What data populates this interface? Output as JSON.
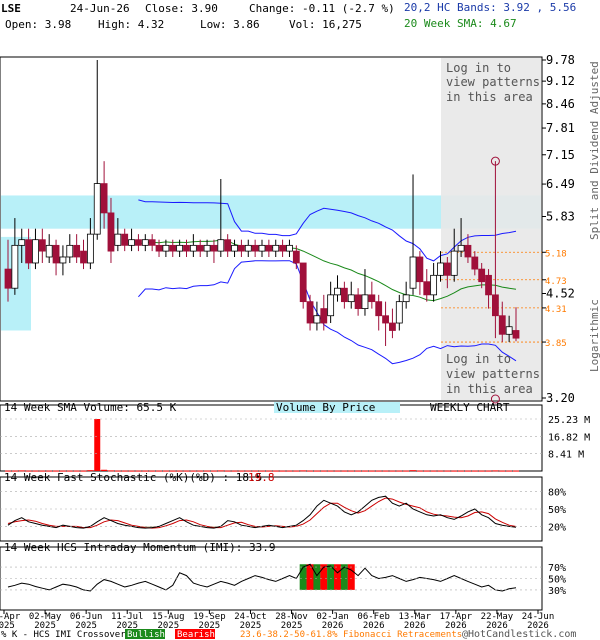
{
  "header": {
    "symbol": "LSE",
    "date": "24-Jun-26",
    "close": "Close: 3.90",
    "change": "Change: -0.11 (-2.7 %)",
    "open": "Open: 3.98",
    "high": "High: 4.32",
    "low": "Low: 3.86",
    "vol": "Vol: 16,275",
    "bands": "20,2 HC Bands: 3.92 , 5.56",
    "sma": "20 Week SMA: 4.67"
  },
  "price_panel": {
    "side_label_top": "Split and Dividend Adjusted",
    "side_label_bottom": "Logarithmic",
    "login_top": [
      "Log in to",
      "view patterns",
      "in this area"
    ],
    "login_bottom": [
      "Log in to",
      "view patterns",
      "in this area"
    ]
  },
  "volume_panel": {
    "title": "14 Week SMA Volume: 65.5 K",
    "center": "Volume By Price",
    "right": "WEEKLY CHART",
    "y_ticks": [
      "25.23 M",
      "16.82 M",
      "8.41 M"
    ]
  },
  "stoch_panel": {
    "title": "14 Week Fast Stochastic (%K)(%D) : 18.5",
    "d_value": "19.8",
    "y_ticks": [
      "80%",
      "50%",
      "20%"
    ]
  },
  "imi_panel": {
    "title": "14 Week HCS Intraday Momentum (IMI): 33.9",
    "y_ticks": [
      "70%",
      "50%",
      "30%"
    ]
  },
  "footer": {
    "legend_prefix": "% K - HCS IMI Crossover,",
    "bullish": "Bullish",
    "bearish": "Bearish",
    "fib": "23.6-38.2-50-61.8% Fibonacci Retracements",
    "credit": "@HotCandlestick.com"
  },
  "colors": {
    "up": "#ffffff",
    "down": "#a0103a",
    "band": "#1a1aff",
    "sma": "#1b8a1b",
    "cyan_zone": "#b8f0f8",
    "fib": "#ff7a00",
    "header_blue": "#1a3aa8",
    "header_green": "#1b8a1b",
    "volume_bar": "#ff0000"
  },
  "chart_data": {
    "type": "candlestick",
    "scale": "log",
    "y_ticks": [
      9.78,
      9.12,
      8.46,
      7.81,
      7.15,
      6.49,
      5.83,
      5.18,
      4.73,
      4.52,
      4.31,
      3.85,
      3.2
    ],
    "fib_levels": [
      5.18,
      4.73,
      4.31,
      3.85
    ],
    "x_labels": [
      [
        "04-Apr",
        "2025"
      ],
      [
        "02-May",
        "2025"
      ],
      [
        "06-Jun",
        "2025"
      ],
      [
        "11-Jul",
        "2025"
      ],
      [
        "15-Aug",
        "2025"
      ],
      [
        "19-Sep",
        "2025"
      ],
      [
        "24-Oct",
        "2025"
      ],
      [
        "28-Nov",
        "2025"
      ],
      [
        "02-Jan",
        "2026"
      ],
      [
        "06-Feb",
        "2026"
      ],
      [
        "13-Mar",
        "2026"
      ],
      [
        "17-Apr",
        "2026"
      ],
      [
        "22-May",
        "2026"
      ],
      [
        "24-Jun",
        "2026"
      ]
    ],
    "candles": [
      [
        4.9,
        4.6,
        5.4,
        4.4
      ],
      [
        4.6,
        5.3,
        5.8,
        4.5
      ],
      [
        5.3,
        5.4,
        5.6,
        5.0
      ],
      [
        5.4,
        5.0,
        5.6,
        4.9
      ],
      [
        5.0,
        5.4,
        5.6,
        4.9
      ],
      [
        5.4,
        5.2,
        5.6,
        5.0
      ],
      [
        5.1,
        5.3,
        5.5,
        5.0
      ],
      [
        5.3,
        5.0,
        5.4,
        4.8
      ],
      [
        5.0,
        5.1,
        5.3,
        4.8
      ],
      [
        5.1,
        5.3,
        5.5,
        5.0
      ],
      [
        5.3,
        5.1,
        5.5,
        5.0
      ],
      [
        5.2,
        5.0,
        5.4,
        4.9
      ],
      [
        5.0,
        5.5,
        5.8,
        4.9
      ],
      [
        5.5,
        6.5,
        9.78,
        5.4
      ],
      [
        6.5,
        5.9,
        7.0,
        5.6
      ],
      [
        5.9,
        5.2,
        6.2,
        5.0
      ],
      [
        5.3,
        5.5,
        5.8,
        5.2
      ],
      [
        5.5,
        5.3,
        5.6,
        5.2
      ],
      [
        5.3,
        5.4,
        5.6,
        5.2
      ],
      [
        5.4,
        5.3,
        5.5,
        5.2
      ],
      [
        5.3,
        5.4,
        5.5,
        5.2
      ],
      [
        5.4,
        5.3,
        5.5,
        5.2
      ],
      [
        5.3,
        5.2,
        5.4,
        5.1
      ],
      [
        5.2,
        5.3,
        5.4,
        5.1
      ],
      [
        5.3,
        5.2,
        5.4,
        5.1
      ],
      [
        5.2,
        5.3,
        5.4,
        5.1
      ],
      [
        5.3,
        5.2,
        5.4,
        5.1
      ],
      [
        5.2,
        5.3,
        5.5,
        5.1
      ],
      [
        5.3,
        5.2,
        5.4,
        5.1
      ],
      [
        5.2,
        5.3,
        5.4,
        5.1
      ],
      [
        5.3,
        5.2,
        5.4,
        5.0
      ],
      [
        5.2,
        5.4,
        6.6,
        5.1
      ],
      [
        5.4,
        5.2,
        5.5,
        5.1
      ],
      [
        5.2,
        5.3,
        5.4,
        5.1
      ],
      [
        5.3,
        5.2,
        5.4,
        5.1
      ],
      [
        5.2,
        5.3,
        5.4,
        5.1
      ],
      [
        5.3,
        5.2,
        5.4,
        5.1
      ],
      [
        5.2,
        5.3,
        5.4,
        5.1
      ],
      [
        5.3,
        5.2,
        5.4,
        5.1
      ],
      [
        5.2,
        5.3,
        5.4,
        5.1
      ],
      [
        5.3,
        5.2,
        5.4,
        5.1
      ],
      [
        5.2,
        5.3,
        5.4,
        5.1
      ],
      [
        5.2,
        5.0,
        5.3,
        4.9
      ],
      [
        5.0,
        4.4,
        5.0,
        4.3
      ],
      [
        4.4,
        4.1,
        4.5,
        4.0
      ],
      [
        4.1,
        4.2,
        4.4,
        4.0
      ],
      [
        4.3,
        4.1,
        4.5,
        4.0
      ],
      [
        4.2,
        4.5,
        4.7,
        4.1
      ],
      [
        4.5,
        4.6,
        4.8,
        4.4
      ],
      [
        4.6,
        4.4,
        4.7,
        4.3
      ],
      [
        4.4,
        4.5,
        4.7,
        4.3
      ],
      [
        4.5,
        4.3,
        4.6,
        4.2
      ],
      [
        4.3,
        4.5,
        4.9,
        4.2
      ],
      [
        4.5,
        4.4,
        4.7,
        4.3
      ],
      [
        4.4,
        4.2,
        4.5,
        4.0
      ],
      [
        4.2,
        4.1,
        4.4,
        3.8
      ],
      [
        4.1,
        4.0,
        4.3,
        3.9
      ],
      [
        4.1,
        4.4,
        4.5,
        4.0
      ],
      [
        4.4,
        4.5,
        4.7,
        4.3
      ],
      [
        4.6,
        5.1,
        6.7,
        4.5
      ],
      [
        5.1,
        4.7,
        5.2,
        4.5
      ],
      [
        4.7,
        4.5,
        4.9,
        4.4
      ],
      [
        4.5,
        4.8,
        5.0,
        4.4
      ],
      [
        4.8,
        5.0,
        5.2,
        4.7
      ],
      [
        5.0,
        4.8,
        5.1,
        4.6
      ],
      [
        4.8,
        5.2,
        5.6,
        4.7
      ],
      [
        5.2,
        5.3,
        5.8,
        5.1
      ],
      [
        5.3,
        5.1,
        5.5,
        5.0
      ],
      [
        5.1,
        4.9,
        5.2,
        4.8
      ],
      [
        4.9,
        4.7,
        5.0,
        4.6
      ],
      [
        4.8,
        4.5,
        4.9,
        4.3
      ],
      [
        4.5,
        4.2,
        7.0,
        3.9
      ],
      [
        4.2,
        3.95,
        4.4,
        3.85
      ],
      [
        3.95,
        4.05,
        4.2,
        3.85
      ],
      [
        4.0,
        3.9,
        4.32,
        3.86
      ]
    ],
    "volume": [
      0.2,
      0.2,
      0.3,
      0.2,
      0.2,
      0.2,
      0.2,
      0.2,
      0.2,
      0.2,
      0.2,
      0.2,
      0.4,
      25.23,
      0.6,
      0.3,
      0.2,
      0.2,
      0.2,
      0.2,
      0.2,
      0.2,
      0.2,
      0.2,
      0.2,
      0.2,
      0.2,
      0.2,
      0.2,
      0.2,
      0.2,
      0.3,
      0.2,
      0.2,
      0.2,
      0.2,
      0.2,
      0.2,
      0.2,
      0.2,
      0.2,
      0.2,
      0.2,
      0.3,
      0.2,
      0.2,
      0.2,
      0.2,
      0.2,
      0.2,
      0.2,
      0.2,
      0.2,
      0.2,
      0.2,
      0.2,
      0.2,
      0.2,
      0.2,
      0.4,
      0.2,
      0.2,
      0.2,
      0.2,
      0.2,
      0.2,
      0.2,
      0.2,
      0.2,
      0.2,
      0.2,
      0.3,
      0.2,
      0.2,
      0.2
    ],
    "stoch_k": [
      22,
      30,
      35,
      28,
      25,
      22,
      20,
      18,
      22,
      20,
      18,
      17,
      20,
      28,
      35,
      30,
      25,
      22,
      20,
      18,
      17,
      18,
      20,
      25,
      30,
      35,
      28,
      22,
      20,
      18,
      17,
      20,
      30,
      28,
      22,
      20,
      18,
      20,
      22,
      20,
      18,
      20,
      22,
      30,
      40,
      55,
      65,
      60,
      55,
      45,
      40,
      45,
      55,
      65,
      70,
      72,
      60,
      55,
      60,
      50,
      45,
      40,
      38,
      40,
      35,
      32,
      38,
      45,
      50,
      40,
      35,
      25,
      22,
      20,
      18.5
    ],
    "stoch_d": [
      25,
      28,
      30,
      31,
      29,
      25,
      22,
      20,
      20,
      20,
      20,
      18,
      18,
      22,
      28,
      31,
      30,
      26,
      22,
      20,
      18,
      17,
      18,
      21,
      25,
      30,
      31,
      28,
      23,
      20,
      18,
      18,
      22,
      26,
      27,
      23,
      20,
      19,
      20,
      21,
      20,
      19,
      20,
      24,
      31,
      42,
      53,
      60,
      60,
      53,
      47,
      43,
      47,
      55,
      63,
      69,
      67,
      62,
      58,
      55,
      52,
      45,
      41,
      39,
      38,
      36,
      35,
      38,
      44,
      45,
      42,
      33,
      27,
      22,
      19.8
    ],
    "imi": [
      35,
      38,
      42,
      40,
      36,
      33,
      30,
      35,
      40,
      38,
      35,
      30,
      28,
      40,
      48,
      45,
      40,
      35,
      38,
      42,
      45,
      40,
      35,
      30,
      38,
      60,
      55,
      42,
      38,
      35,
      40,
      45,
      42,
      38,
      45,
      50,
      55,
      52,
      48,
      45,
      50,
      55,
      50,
      70,
      75,
      55,
      70,
      72,
      60,
      70,
      65,
      55,
      68,
      55,
      50,
      52,
      55,
      50,
      45,
      48,
      52,
      50,
      48,
      45,
      50,
      55,
      50,
      45,
      40,
      35,
      38,
      30,
      28,
      32,
      33.9
    ],
    "imi_crossovers": [
      {
        "index": 43,
        "kind": "bullish"
      },
      {
        "index": 44,
        "kind": "bearish"
      },
      {
        "index": 45,
        "kind": "bullish"
      },
      {
        "index": 46,
        "kind": "bearish"
      },
      {
        "index": 47,
        "kind": "bullish"
      },
      {
        "index": 48,
        "kind": "bearish"
      },
      {
        "index": 49,
        "kind": "bullish"
      },
      {
        "index": 50,
        "kind": "bearish"
      }
    ]
  }
}
